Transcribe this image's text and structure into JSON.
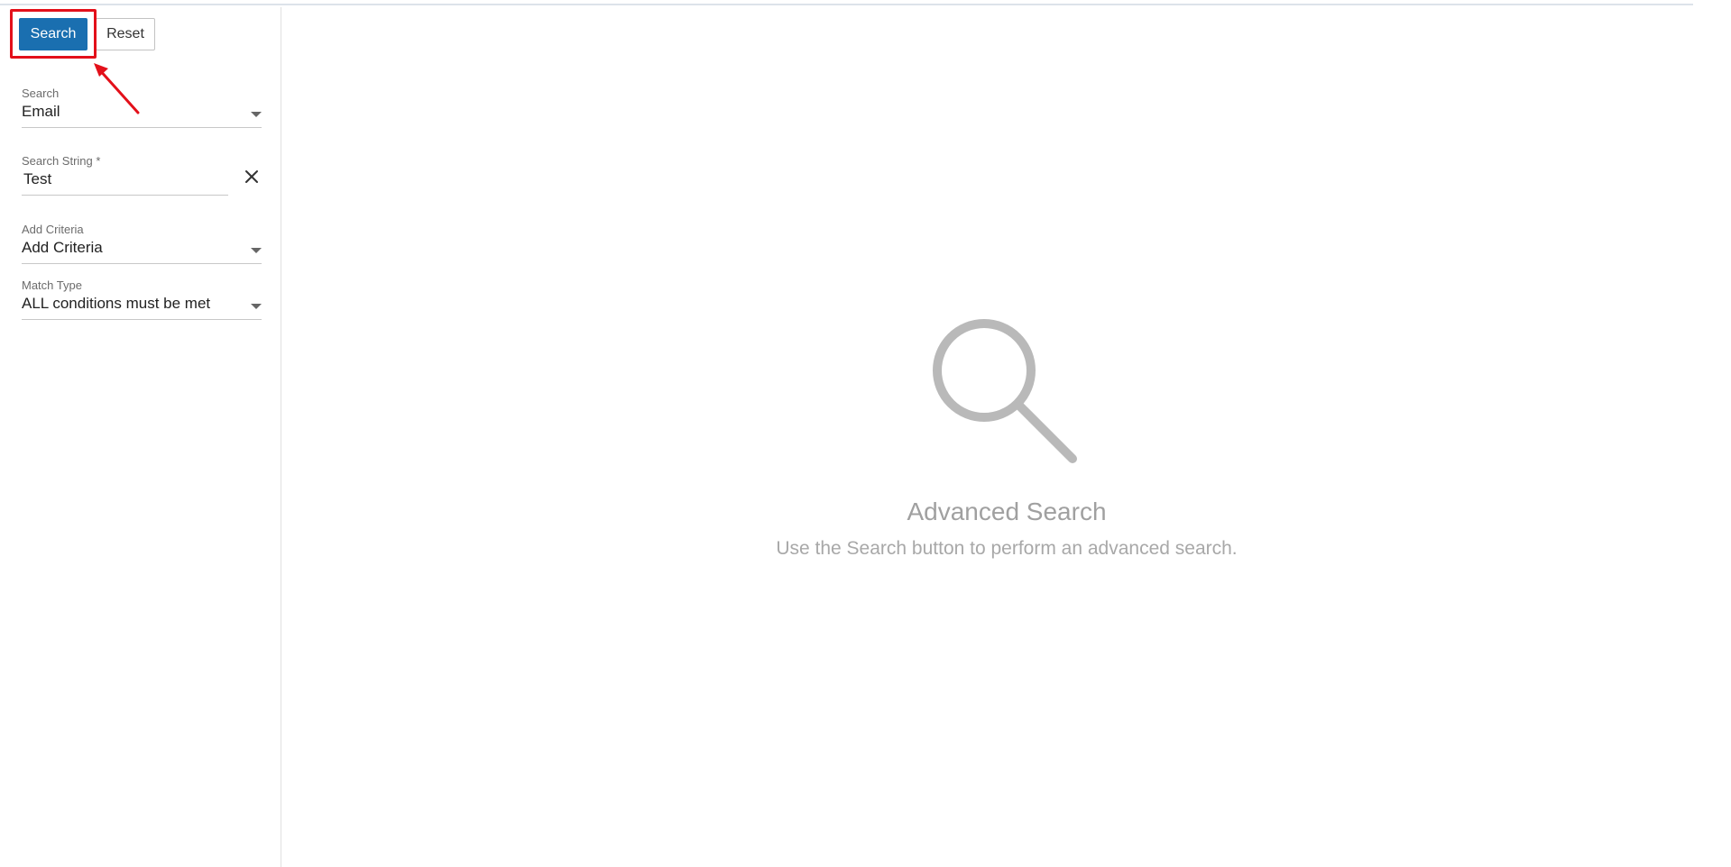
{
  "toolbar": {
    "search_label": "Search",
    "reset_label": "Reset"
  },
  "fields": {
    "search": {
      "label": "Search",
      "value": "Email"
    },
    "search_string": {
      "label": "Search String *",
      "value": "Test"
    },
    "add_criteria": {
      "label": "Add Criteria",
      "value": "Add Criteria"
    },
    "match_type": {
      "label": "Match Type",
      "value": "ALL conditions must be met"
    }
  },
  "empty_state": {
    "icon": "magnifier-icon",
    "title": "Advanced Search",
    "subtitle": "Use the Search button to perform an advanced search."
  },
  "colors": {
    "primary_button": "#1a6fb0",
    "annotation": "#e3101a",
    "empty_state": "#a0a0a0"
  }
}
